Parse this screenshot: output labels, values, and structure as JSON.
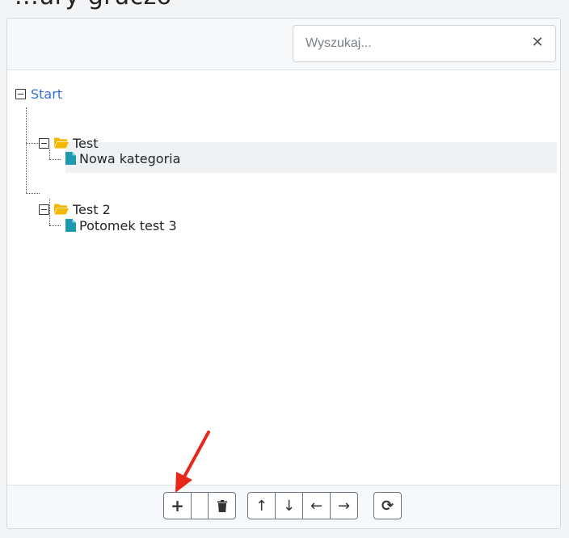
{
  "header": {
    "partial_title": "...ury gruczo"
  },
  "search": {
    "placeholder": "Wyszukaj...",
    "value": "",
    "clear_icon": "close-icon"
  },
  "tree": {
    "root": {
      "label": "Start",
      "expanded": true
    },
    "children": [
      {
        "label": "Test",
        "icon": "folder-open-icon",
        "expanded": true,
        "children": [
          {
            "label": "Nowa kategoria",
            "icon": "document-icon",
            "selected": true
          }
        ]
      },
      {
        "label": "Test 2",
        "icon": "folder-open-icon",
        "expanded": true,
        "children": [
          {
            "label": "Potomek test 3",
            "icon": "document-icon",
            "selected": false
          }
        ]
      }
    ]
  },
  "toolbar": {
    "buttons": [
      {
        "name": "add",
        "icon": "plus-icon",
        "glyph": "+"
      },
      {
        "name": "blank",
        "icon": "",
        "glyph": ""
      },
      {
        "name": "delete",
        "icon": "trash-icon",
        "glyph": ""
      },
      {
        "name": "move-up",
        "icon": "arrow-up-icon",
        "glyph": "↑"
      },
      {
        "name": "move-down",
        "icon": "arrow-down-icon",
        "glyph": "↓"
      },
      {
        "name": "outdent",
        "icon": "arrow-left-icon",
        "glyph": "←"
      },
      {
        "name": "indent",
        "icon": "arrow-right-icon",
        "glyph": "→"
      },
      {
        "name": "refresh",
        "icon": "refresh-icon",
        "glyph": "⟳"
      }
    ]
  },
  "annotation": {
    "arrow_color": "#e8261c",
    "target": "add-button"
  },
  "colors": {
    "link": "#2f6fd6",
    "folder": "#f5b800",
    "document": "#1e9ab0",
    "selected_bg": "#f0f1f2"
  }
}
